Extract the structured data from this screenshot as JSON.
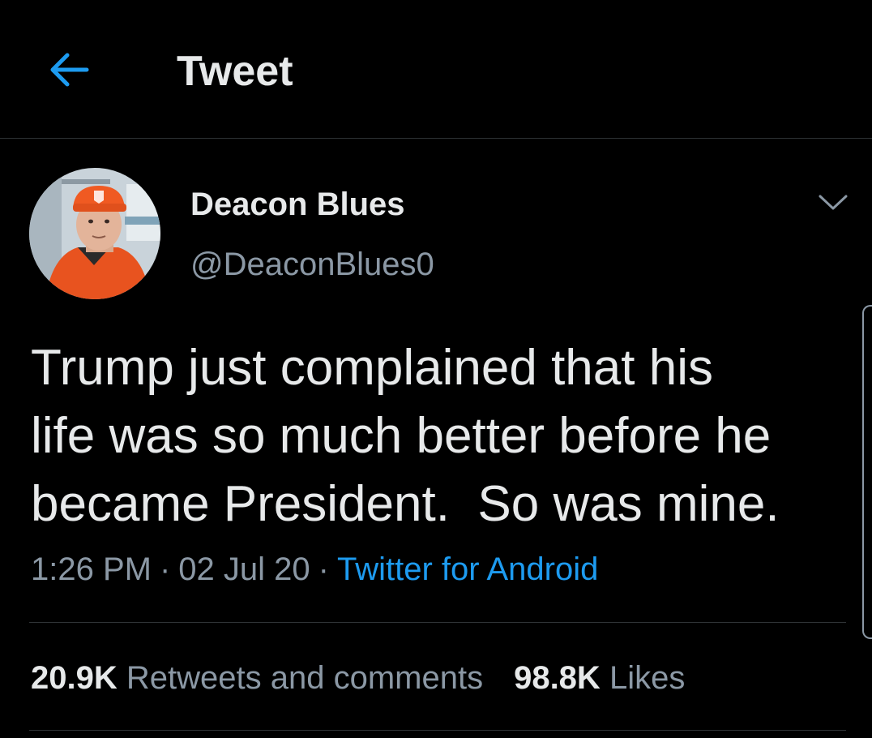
{
  "header": {
    "title": "Tweet",
    "back_icon": "arrow-left-icon"
  },
  "author": {
    "display_name": "Deacon Blues",
    "handle": "@DeaconBlues0",
    "avatar_icon": "profile-photo"
  },
  "tweet": {
    "text": "Trump just complained that his\nlife was so much better before he\nbecame President.  So was mine."
  },
  "meta": {
    "time": "1:26 PM",
    "date": "02 Jul 20",
    "source": "Twitter for Android",
    "separator": "·"
  },
  "stats": {
    "retweets_count": "20.9K",
    "retweets_label": "Retweets and comments",
    "likes_count": "98.8K",
    "likes_label": "Likes"
  },
  "colors": {
    "background": "#000000",
    "primary_text": "#e7e9ea",
    "secondary_text": "#8b98a5",
    "accent": "#1d9bf0",
    "divider": "#2f3336"
  }
}
